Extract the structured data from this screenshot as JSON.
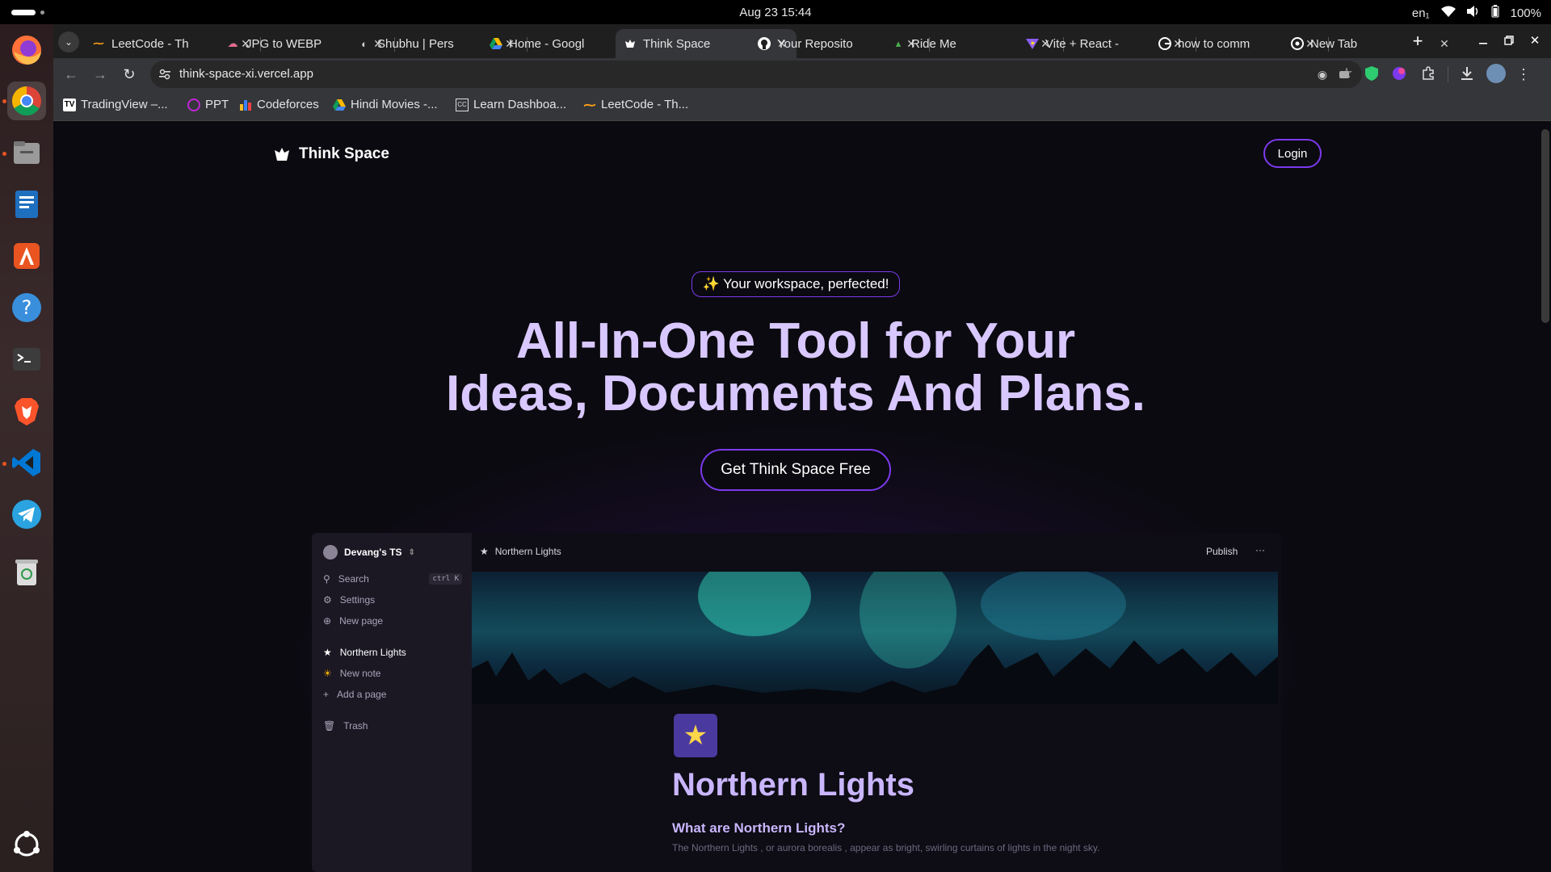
{
  "os": {
    "clock": "Aug 23  15:44",
    "lang": "en₁",
    "battery": "100%"
  },
  "browser": {
    "tabs": [
      {
        "title": "LeetCode - Th",
        "icon": "leetcode-icon"
      },
      {
        "title": "JPG to WEBP",
        "icon": "cloud-icon"
      },
      {
        "title": "Shubhu | Pers",
        "icon": "globe-icon"
      },
      {
        "title": "Home - Googl",
        "icon": "google-drive-icon"
      },
      {
        "title": "Think Space",
        "icon": "think-space-icon"
      },
      {
        "title": "Your Reposito",
        "icon": "github-icon"
      },
      {
        "title": "Ride Me",
        "icon": "ride-icon"
      },
      {
        "title": "Vite + React -",
        "icon": "vite-icon"
      },
      {
        "title": "how to comm",
        "icon": "google-icon"
      },
      {
        "title": "New Tab",
        "icon": "chrome-icon"
      }
    ],
    "url": "think-space-xi.vercel.app",
    "bookmarks": [
      {
        "label": "TradingView –...",
        "icon": "tradingview-icon"
      },
      {
        "label": "PPT",
        "icon": "ppt-icon"
      },
      {
        "label": "Codeforces",
        "icon": "codeforces-icon"
      },
      {
        "label": "Hindi Movies -...",
        "icon": "drive-icon"
      },
      {
        "label": "Learn Dashboa...",
        "icon": "cc-icon"
      },
      {
        "label": "LeetCode - Th...",
        "icon": "leetcode-icon"
      }
    ]
  },
  "site": {
    "logo_text": "Think Space",
    "login": "Login",
    "badge": "✨ Your workspace, perfected!",
    "hero_line1": "All-In-One Tool for Your",
    "hero_line2": "Ideas, Documents And Plans.",
    "cta": "Get Think Space Free",
    "accent": "#7c3aed",
    "heading_color": "#d9c8ff"
  },
  "preview": {
    "workspace": "Devang's TS",
    "sidebar": {
      "search": "Search",
      "search_shortcut": "ctrl K",
      "settings": "Settings",
      "new_page": "New page",
      "pages": [
        {
          "label": "Northern Lights",
          "icon": "shooting-star-icon"
        },
        {
          "label": "New note",
          "icon": "sun-icon"
        }
      ],
      "add_page": "Add a page",
      "trash": "Trash"
    },
    "breadcrumb": "Northern Lights",
    "publish": "Publish",
    "more": "···",
    "doc_title": "Northern Lights",
    "doc_heading": "What are Northern Lights?",
    "doc_text": "The Northern Lights , or aurora borealis , appear as bright, swirling curtains of lights in the night sky."
  }
}
